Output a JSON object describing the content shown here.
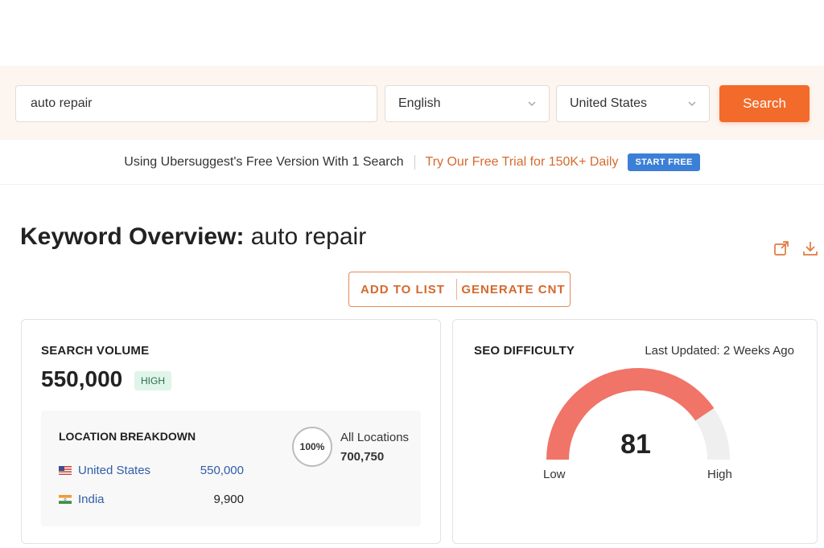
{
  "search": {
    "keyword": "auto repair",
    "language": "English",
    "country": "United States",
    "button_label": "Search"
  },
  "promo": {
    "free_text": "Using Ubersuggest's Free Version With 1 Search",
    "trial_text": "Try Our Free Trial for 150K+ Daily",
    "start_label": "START FREE",
    "accent_color": "#3b7fd6"
  },
  "overview": {
    "title_bold": "Keyword Overview:",
    "title_keyword": "auto repair",
    "icons": [
      "share-icon",
      "download-icon"
    ]
  },
  "actions": {
    "add_to_list": "ADD TO LIST",
    "generate": "GENERATE CNT"
  },
  "search_volume": {
    "label": "SEARCH VOLUME",
    "value": "550,000",
    "badge": "HIGH",
    "breakdown": {
      "title": "LOCATION BREAKDOWN",
      "rows": [
        {
          "country": "United States",
          "volume": "550,000",
          "flag_icon": "us-flag-icon"
        },
        {
          "country": "India",
          "volume": "9,900",
          "flag_icon": "india-flag-icon"
        }
      ],
      "percent": "100%",
      "all_label": "All Locations",
      "all_value": "700,750"
    }
  },
  "seo_difficulty": {
    "label": "SEO DIFFICULTY",
    "last_updated": "Last Updated: 2 Weeks Ago",
    "value": "81",
    "score": 81,
    "max": 100,
    "low_label": "Low",
    "high_label": "High",
    "fill_color": "#f07468",
    "track_color": "#efefef"
  },
  "colors": {
    "brand_orange": "#f26b2a",
    "link_blue": "#2f5ea8",
    "badge_green": "#dff5ea"
  }
}
